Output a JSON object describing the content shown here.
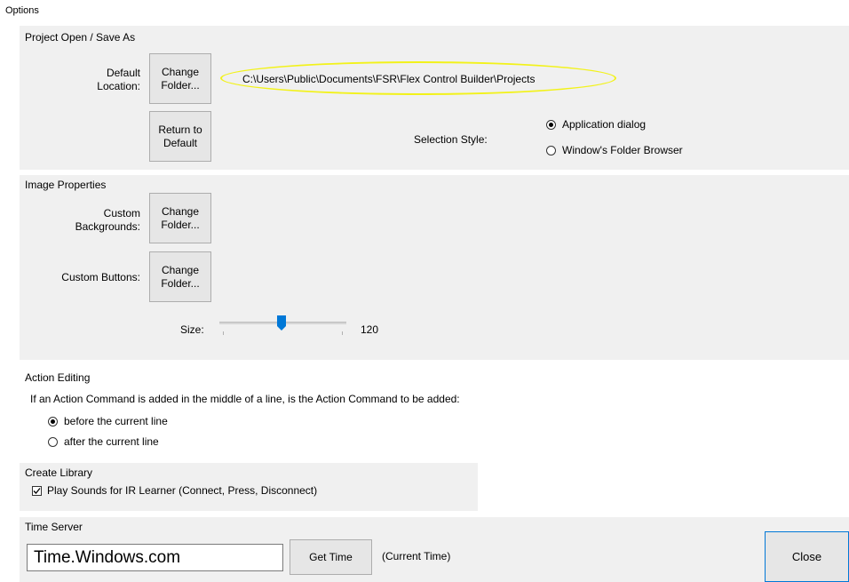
{
  "window": {
    "title": "Options"
  },
  "project": {
    "title": "Project Open / Save As",
    "default_location_label": "Default\nLocation:",
    "change_folder_label": "Change\nFolder...",
    "path": "C:\\Users\\Public\\Documents\\FSR\\Flex Control Builder\\Projects",
    "return_default_label": "Return to\nDefault",
    "selection_style_label": "Selection Style:",
    "selection_options": [
      {
        "label": "Application dialog",
        "checked": true
      },
      {
        "label": "Window's Folder Browser",
        "checked": false
      }
    ]
  },
  "image": {
    "title": "Image Properties",
    "custom_backgrounds_label": "Custom\nBackgrounds:",
    "custom_buttons_label": "Custom Buttons:",
    "change_folder_label": "Change\nFolder...",
    "size_label": "Size:",
    "size_value": "120"
  },
  "action": {
    "title": "Action Editing",
    "question": "If an Action Command is added in the middle of a line, is the Action Command to be added:",
    "options": [
      {
        "label": "before the current line",
        "checked": true
      },
      {
        "label": "after the current line",
        "checked": false
      }
    ]
  },
  "library": {
    "title": "Create Library",
    "play_sounds_label": "Play Sounds for IR Learner (Connect, Press, Disconnect)",
    "play_sounds_checked": true
  },
  "time_server": {
    "title": "Time Server",
    "server_value": "Time.Windows.com",
    "get_time_label": "Get Time",
    "current_time_label": "(Current Time)"
  },
  "close_label": "Close"
}
